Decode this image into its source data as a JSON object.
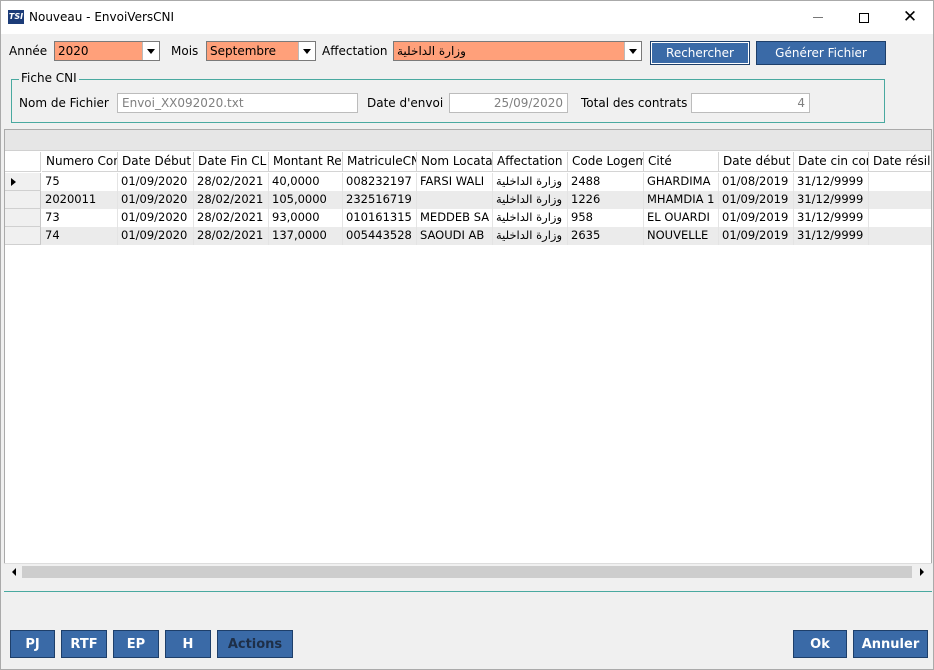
{
  "window": {
    "title": "Nouveau - EnvoiVersCNI",
    "app_icon_text": "TSI"
  },
  "filters": {
    "annee_label": "Année",
    "annee_value": "2020",
    "mois_label": "Mois",
    "mois_value": "Septembre",
    "affectation_label": "Affectation",
    "affectation_value": "وزارة الداخلية",
    "combo_color": "#ffa07a"
  },
  "buttons": {
    "rechercher": "Rechercher",
    "generer": "Générer Fichier"
  },
  "fiche": {
    "title": "Fiche CNI",
    "nom_fichier_label": "Nom de Fichier",
    "nom_fichier_value": "Envoi_XX092020.txt",
    "date_envoi_label": "Date d'envoi",
    "date_envoi_value": "25/09/2020",
    "total_label": "Total des contrats",
    "total_value": "4"
  },
  "grid": {
    "columns": [
      "Numero Con",
      "Date Début",
      "Date Fin CL",
      "Montant Ret",
      "MatriculeCN",
      "Nom Locatai",
      "Affectation",
      "Code Logem",
      "Cité",
      "Date début",
      "Date cin con",
      "Date résilia"
    ],
    "rows": [
      [
        "75",
        "01/09/2020",
        "28/02/2021",
        "40,0000",
        "008232197",
        "FARSI WALI",
        "وزارة الداخلية",
        "2488",
        "GHARDIMA",
        "01/08/2019",
        "31/12/9999",
        ""
      ],
      [
        "2020011",
        "01/09/2020",
        "28/02/2021",
        "105,0000",
        "232516719",
        "",
        "وزارة الداخلية",
        "1226",
        "MHAMDIA 1",
        "01/09/2019",
        "31/12/9999",
        ""
      ],
      [
        "73",
        "01/09/2020",
        "28/02/2021",
        "93,0000",
        "010161315",
        "MEDDEB SA",
        "وزارة الداخلية",
        "958",
        "EL OUARDI",
        "01/09/2019",
        "31/12/9999",
        ""
      ],
      [
        "74",
        "01/09/2020",
        "28/02/2021",
        "137,0000",
        "005443528",
        "SAOUDI AB",
        "وزارة الداخلية",
        "2635",
        "NOUVELLE",
        "01/09/2019",
        "31/12/9999",
        ""
      ]
    ]
  },
  "footer": {
    "pj": "PJ",
    "rtf": "RTF",
    "ep": "EP",
    "h": "H",
    "actions": "Actions",
    "ok": "Ok",
    "annuler": "Annuler"
  },
  "colors": {
    "button_blue": "#3a6aa7",
    "group_border": "#49a9a0"
  }
}
